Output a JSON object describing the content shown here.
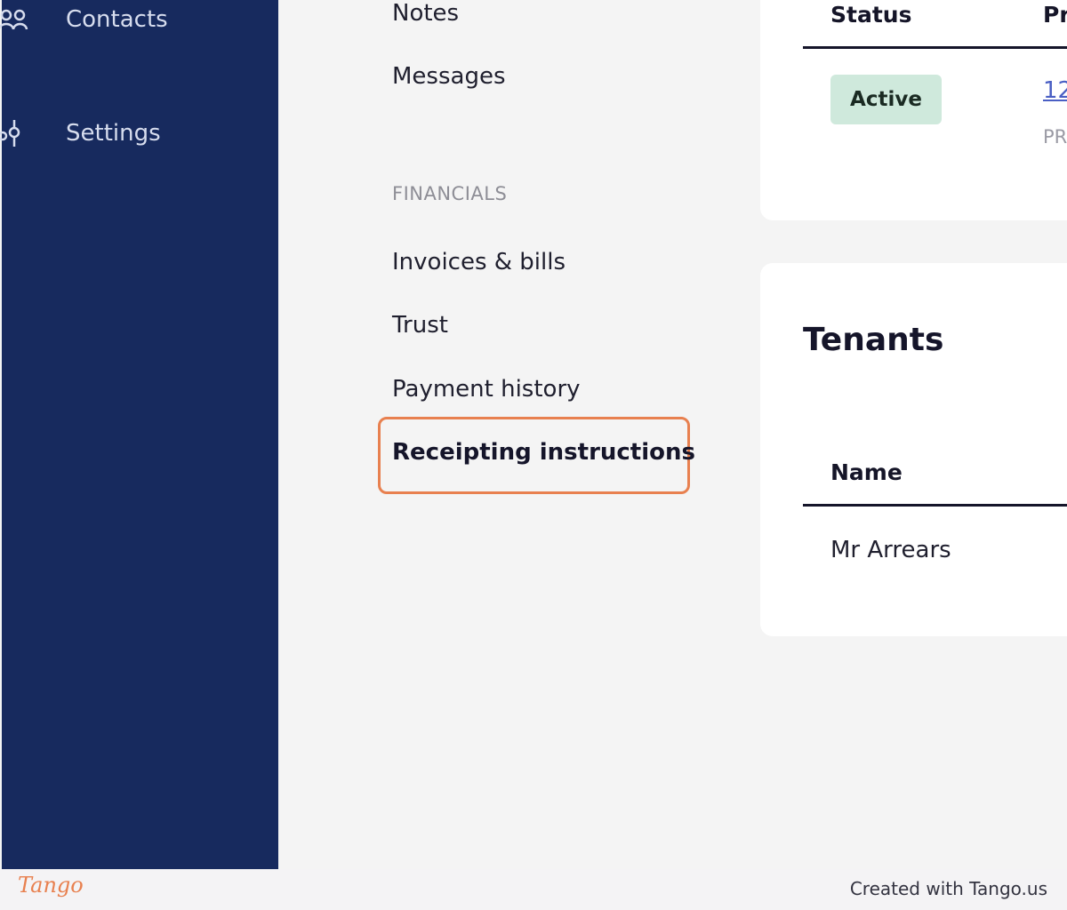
{
  "sidebar": {
    "items": [
      {
        "label": "Contacts",
        "icon": "contacts-icon"
      },
      {
        "label": "Settings",
        "icon": "settings-icon"
      }
    ]
  },
  "subnav": {
    "items": [
      {
        "label": "Notes"
      },
      {
        "label": "Messages"
      }
    ],
    "financials_heading": "FINANCIALS",
    "financial_items": [
      {
        "label": "Invoices & bills"
      },
      {
        "label": "Trust"
      },
      {
        "label": "Payment history"
      },
      {
        "label": "Receipting instructions",
        "active": true
      }
    ]
  },
  "top_card": {
    "status_header": "Status",
    "second_header": "Pr",
    "status_badge": "Active",
    "link_text": "12",
    "muted_text": "PR",
    "badge_color": "#cfe9dc"
  },
  "tenants_card": {
    "title": "Tenants",
    "column_header": "Name",
    "rows": [
      {
        "name": "Mr Arrears"
      }
    ]
  },
  "footer": {
    "logo": "Tango",
    "credit": "Created with Tango.us"
  },
  "colors": {
    "sidebar_bg": "#172a5e",
    "highlight": "#e8804f",
    "link": "#4a5fc4"
  }
}
